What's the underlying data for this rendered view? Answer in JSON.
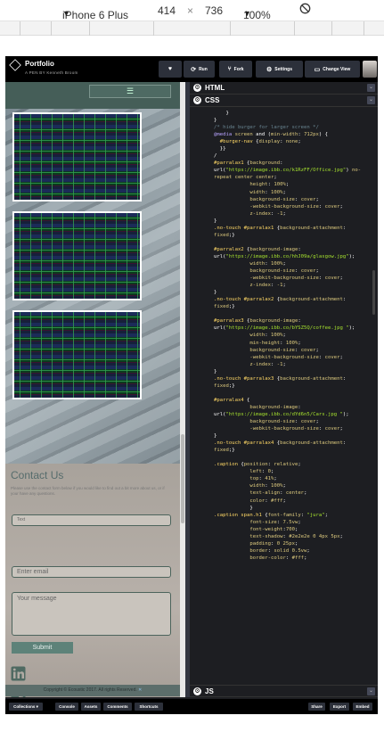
{
  "device_toolbar": {
    "device": "iPhone 6 Plus",
    "width": "414",
    "times": "×",
    "height": "736",
    "zoom": "100%"
  },
  "pen": {
    "title": "Portfolio",
    "byline": "A PEN BY Kenneth Broom",
    "buttons": {
      "heart": "♥",
      "run": "Run",
      "fork": "Fork",
      "settings": "Settings",
      "change_view": "Change View"
    }
  },
  "preview": {
    "burger": "☰",
    "contact_title": "Contact Us",
    "contact_sub": "Please use the contact form below if you would like to find out a bit more about us, or if your have any questions.",
    "name_placeholder": "Text",
    "email_placeholder": "Enter email",
    "message_placeholder": "Your message",
    "submit_label": "Submit",
    "copyright": "Copyright © Ecoustic 2017. All rights Reserved."
  },
  "editor": {
    "html_label": "HTML",
    "css_label": "CSS",
    "js_label": "JS",
    "code_lines": [
      [
        [
          "prop",
          "    }"
        ]
      ],
      [
        [
          "prop",
          "}"
        ]
      ],
      [
        [
          "com",
          "/* hide burger for larger screen */"
        ]
      ],
      [
        [
          "kw",
          "@media "
        ],
        [
          "key",
          "screen "
        ],
        [
          "prop",
          "and ("
        ],
        [
          "key",
          "min-width"
        ],
        [
          "prop",
          ": "
        ],
        [
          "val",
          "712px"
        ],
        [
          "prop",
          ") {"
        ]
      ],
      [
        [
          "sel",
          "  #burger-nav "
        ],
        [
          "prop",
          "{"
        ],
        [
          "key",
          "display"
        ],
        [
          "prop",
          ": "
        ],
        [
          "val",
          "none"
        ],
        [
          "prop",
          ";"
        ]
      ],
      [
        [
          "prop",
          "  }}"
        ]
      ],
      [
        [
          "prop",
          "/"
        ]
      ],
      [
        [
          "sel",
          "#parralax1 "
        ],
        [
          "prop",
          "{"
        ],
        [
          "key",
          "background"
        ],
        [
          "prop",
          ":"
        ]
      ],
      [
        [
          "prop",
          "url("
        ],
        [
          "str",
          "\"https://image.ibb.co/k1RzFF/Office.jpg\""
        ],
        [
          "prop",
          ") "
        ],
        [
          "val",
          "no-"
        ]
      ],
      [
        [
          "val",
          "repeat center center"
        ],
        [
          "prop",
          ";"
        ]
      ],
      [
        [
          "key",
          "            height"
        ],
        [
          "prop",
          ": "
        ],
        [
          "val",
          "100%"
        ],
        [
          "prop",
          ";"
        ]
      ],
      [
        [
          "key",
          "            width"
        ],
        [
          "prop",
          ": "
        ],
        [
          "val",
          "100%"
        ],
        [
          "prop",
          ";"
        ]
      ],
      [
        [
          "key",
          "            background-size"
        ],
        [
          "prop",
          ": "
        ],
        [
          "val",
          "cover"
        ],
        [
          "prop",
          ";"
        ]
      ],
      [
        [
          "key",
          "            -webkit-background-size"
        ],
        [
          "prop",
          ": "
        ],
        [
          "val",
          "cover"
        ],
        [
          "prop",
          ";"
        ]
      ],
      [
        [
          "key",
          "            z-index"
        ],
        [
          "prop",
          ": "
        ],
        [
          "val",
          "-1"
        ],
        [
          "prop",
          ";"
        ]
      ],
      [
        [
          "prop",
          "}"
        ]
      ],
      [
        [
          "sel",
          ".no-touch #parralax1 "
        ],
        [
          "prop",
          "{"
        ],
        [
          "key",
          "background-attachment"
        ],
        [
          "prop",
          ":"
        ]
      ],
      [
        [
          "val",
          "fixed"
        ],
        [
          "prop",
          ";}"
        ]
      ],
      [
        [
          "prop",
          ""
        ]
      ],
      [
        [
          "sel",
          "#parralax2 "
        ],
        [
          "prop",
          "{"
        ],
        [
          "key",
          "background-image"
        ],
        [
          "prop",
          ":"
        ]
      ],
      [
        [
          "prop",
          "url("
        ],
        [
          "str",
          "\"https://image.ibb.co/hhJ09a/glasgow.jpg\""
        ],
        [
          "prop",
          ");"
        ]
      ],
      [
        [
          "key",
          "            width"
        ],
        [
          "prop",
          ": "
        ],
        [
          "val",
          "100%"
        ],
        [
          "prop",
          ";"
        ]
      ],
      [
        [
          "key",
          "            background-size"
        ],
        [
          "prop",
          ": "
        ],
        [
          "val",
          "cover"
        ],
        [
          "prop",
          ";"
        ]
      ],
      [
        [
          "key",
          "            -webkit-background-size"
        ],
        [
          "prop",
          ": "
        ],
        [
          "val",
          "cover"
        ],
        [
          "prop",
          ";"
        ]
      ],
      [
        [
          "key",
          "            z-index"
        ],
        [
          "prop",
          ": "
        ],
        [
          "val",
          "-1"
        ],
        [
          "prop",
          ";"
        ]
      ],
      [
        [
          "prop",
          "}"
        ]
      ],
      [
        [
          "sel",
          ".no-touch #parralax2 "
        ],
        [
          "prop",
          "{"
        ],
        [
          "key",
          "background-attachment"
        ],
        [
          "prop",
          ":"
        ]
      ],
      [
        [
          "val",
          "fixed"
        ],
        [
          "prop",
          ";}"
        ]
      ],
      [
        [
          "prop",
          ""
        ]
      ],
      [
        [
          "sel",
          "#parralax3 "
        ],
        [
          "prop",
          "{"
        ],
        [
          "key",
          "background-image"
        ],
        [
          "prop",
          ":"
        ]
      ],
      [
        [
          "prop",
          "url("
        ],
        [
          "str",
          "\"https://image.ibb.co/bYSZ5Q/coffee.jpg \""
        ],
        [
          "prop",
          ");"
        ]
      ],
      [
        [
          "key",
          "            width"
        ],
        [
          "prop",
          ": "
        ],
        [
          "val",
          "100%"
        ],
        [
          "prop",
          ";"
        ]
      ],
      [
        [
          "key",
          "            min-height"
        ],
        [
          "prop",
          ": "
        ],
        [
          "val",
          "100%"
        ],
        [
          "prop",
          ";"
        ]
      ],
      [
        [
          "key",
          "            background-size"
        ],
        [
          "prop",
          ": "
        ],
        [
          "val",
          "cover"
        ],
        [
          "prop",
          ";"
        ]
      ],
      [
        [
          "key",
          "            -webkit-background-size"
        ],
        [
          "prop",
          ": "
        ],
        [
          "val",
          "cover"
        ],
        [
          "prop",
          ";"
        ]
      ],
      [
        [
          "key",
          "            z-index"
        ],
        [
          "prop",
          ": "
        ],
        [
          "val",
          "-1"
        ],
        [
          "prop",
          ";"
        ]
      ],
      [
        [
          "prop",
          "}"
        ]
      ],
      [
        [
          "sel",
          ".no-touch #parralax3 "
        ],
        [
          "prop",
          "{"
        ],
        [
          "key",
          "background-attachment"
        ],
        [
          "prop",
          ":"
        ]
      ],
      [
        [
          "val",
          "fixed"
        ],
        [
          "prop",
          ";}"
        ]
      ],
      [
        [
          "prop",
          ""
        ]
      ],
      [
        [
          "sel",
          "#parralax4 "
        ],
        [
          "prop",
          "{"
        ]
      ],
      [
        [
          "key",
          "            background-image"
        ],
        [
          "prop",
          ":"
        ]
      ],
      [
        [
          "prop",
          "url("
        ],
        [
          "str",
          "\"https://image.ibb.co/dYd6n5/Cars.jpg \""
        ],
        [
          "prop",
          ");"
        ]
      ],
      [
        [
          "key",
          "            background-size"
        ],
        [
          "prop",
          ": "
        ],
        [
          "val",
          "cover"
        ],
        [
          "prop",
          ";"
        ]
      ],
      [
        [
          "key",
          "            -webkit-background-size"
        ],
        [
          "prop",
          ": "
        ],
        [
          "val",
          "cover"
        ],
        [
          "prop",
          ";"
        ]
      ],
      [
        [
          "prop",
          "}"
        ]
      ],
      [
        [
          "sel",
          ".no-touch #parralax4 "
        ],
        [
          "prop",
          "{"
        ],
        [
          "key",
          "background-attachment"
        ],
        [
          "prop",
          ":"
        ]
      ],
      [
        [
          "val",
          "fixed"
        ],
        [
          "prop",
          ";}"
        ]
      ],
      [
        [
          "prop",
          ""
        ]
      ],
      [
        [
          "sel",
          ".caption "
        ],
        [
          "prop",
          "{"
        ],
        [
          "key",
          "position"
        ],
        [
          "prop",
          ": "
        ],
        [
          "val",
          "relative"
        ],
        [
          "prop",
          ";"
        ]
      ],
      [
        [
          "key",
          "            left"
        ],
        [
          "prop",
          ": "
        ],
        [
          "val",
          "0"
        ],
        [
          "prop",
          ";"
        ]
      ],
      [
        [
          "key",
          "            top"
        ],
        [
          "prop",
          ": "
        ],
        [
          "val",
          "41%"
        ],
        [
          "prop",
          ";"
        ]
      ],
      [
        [
          "key",
          "            width"
        ],
        [
          "prop",
          ": "
        ],
        [
          "val",
          "100%"
        ],
        [
          "prop",
          ";"
        ]
      ],
      [
        [
          "key",
          "            text-align"
        ],
        [
          "prop",
          ": "
        ],
        [
          "val",
          "center"
        ],
        [
          "prop",
          ";"
        ]
      ],
      [
        [
          "key",
          "            color"
        ],
        [
          "prop",
          ": "
        ],
        [
          "val",
          "#fff"
        ],
        [
          "prop",
          ";"
        ]
      ],
      [
        [
          "prop",
          "            }"
        ]
      ],
      [
        [
          "sel",
          ".caption span.h1 "
        ],
        [
          "prop",
          "{"
        ],
        [
          "key",
          "font-family"
        ],
        [
          "prop",
          ": "
        ],
        [
          "str",
          "\"jura\""
        ],
        [
          "prop",
          ";"
        ]
      ],
      [
        [
          "key",
          "            font-size"
        ],
        [
          "prop",
          ": "
        ],
        [
          "val",
          "7.5vw"
        ],
        [
          "prop",
          ";"
        ]
      ],
      [
        [
          "key",
          "            font-weight"
        ],
        [
          "prop",
          ":"
        ],
        [
          "val",
          "700"
        ],
        [
          "prop",
          ";"
        ]
      ],
      [
        [
          "key",
          "            text-shadow"
        ],
        [
          "prop",
          ": "
        ],
        [
          "val",
          "#2e2e2e 0 4px 5px"
        ],
        [
          "prop",
          ";"
        ]
      ],
      [
        [
          "key",
          "            padding"
        ],
        [
          "prop",
          ": "
        ],
        [
          "val",
          "0 25px"
        ],
        [
          "prop",
          ";"
        ]
      ],
      [
        [
          "key",
          "            border"
        ],
        [
          "prop",
          ": "
        ],
        [
          "val",
          "solid 0.5vw"
        ],
        [
          "prop",
          ";"
        ]
      ],
      [
        [
          "key",
          "            border-color"
        ],
        [
          "prop",
          ": "
        ],
        [
          "val",
          "#fff"
        ],
        [
          "prop",
          ";"
        ]
      ]
    ]
  },
  "footer": {
    "collections": "Collections",
    "console": "Console",
    "assets": "Assets",
    "comments": "Comments",
    "shortcuts": "Shortcuts",
    "share": "Share",
    "export": "Export",
    "embed": "Embed"
  },
  "colors": {
    "editor_bg": "#1d1e22",
    "header_bg": "#000000",
    "button_bg": "#2c303a",
    "accent_teal": "#5d8279"
  }
}
